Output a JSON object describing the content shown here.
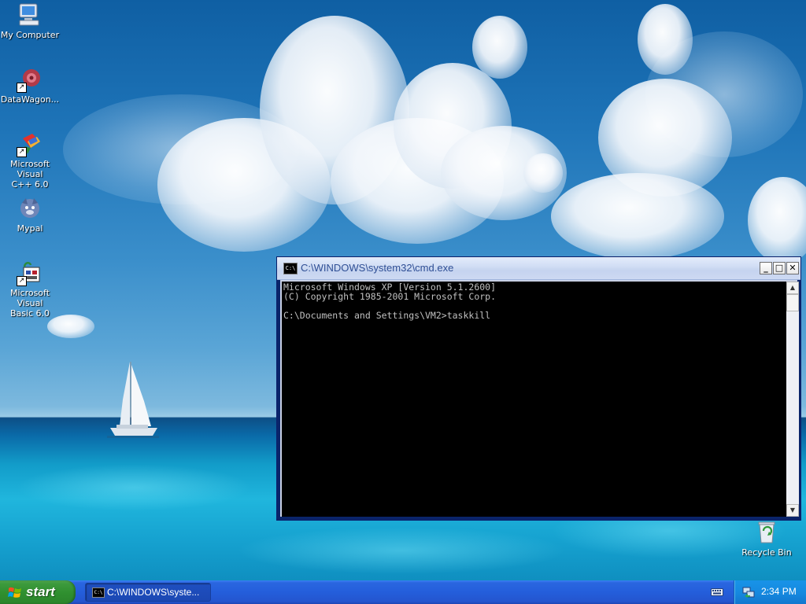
{
  "desktop": {
    "icons": [
      {
        "name": "my-computer",
        "label": "My Computer",
        "icon": "my-computer-icon"
      },
      {
        "name": "datawagon",
        "label": "DataWagon...",
        "icon": "datawagon-icon"
      },
      {
        "name": "msvc",
        "label_line1": "Microsoft Visual",
        "label_line2": "C++ 6.0",
        "icon": "visual-cpp-icon"
      },
      {
        "name": "mypal",
        "label": "Mypal",
        "icon": "mypal-icon"
      },
      {
        "name": "msvb",
        "label_line1": "Microsoft Visual",
        "label_line2": "Basic 6.0",
        "icon": "visual-basic-icon"
      },
      {
        "name": "recycle-bin",
        "label": "Recycle Bin",
        "icon": "recycle-bin-icon"
      }
    ]
  },
  "cmd_window": {
    "title": "C:\\WINDOWS\\system32\\cmd.exe",
    "icon_text": "C:\\",
    "lines": [
      "Microsoft Windows XP [Version 5.1.2600]",
      "(C) Copyright 1985-2001 Microsoft Corp.",
      "",
      "C:\\Documents and Settings\\VM2>taskkill"
    ],
    "minimize_symbol": "_",
    "maximize_symbol": "□",
    "close_symbol": "✕"
  },
  "taskbar": {
    "start_label": "start",
    "tasks": [
      {
        "label": "C:\\WINDOWS\\syste...",
        "icon": "cmd-icon"
      }
    ],
    "clock": "2:34 PM"
  },
  "colors": {
    "taskbar_blue": "#245edb",
    "start_green": "#3c9a3c",
    "tray_blue": "#168ae0",
    "console_bg": "#000000",
    "console_text": "#c0c0c0"
  }
}
